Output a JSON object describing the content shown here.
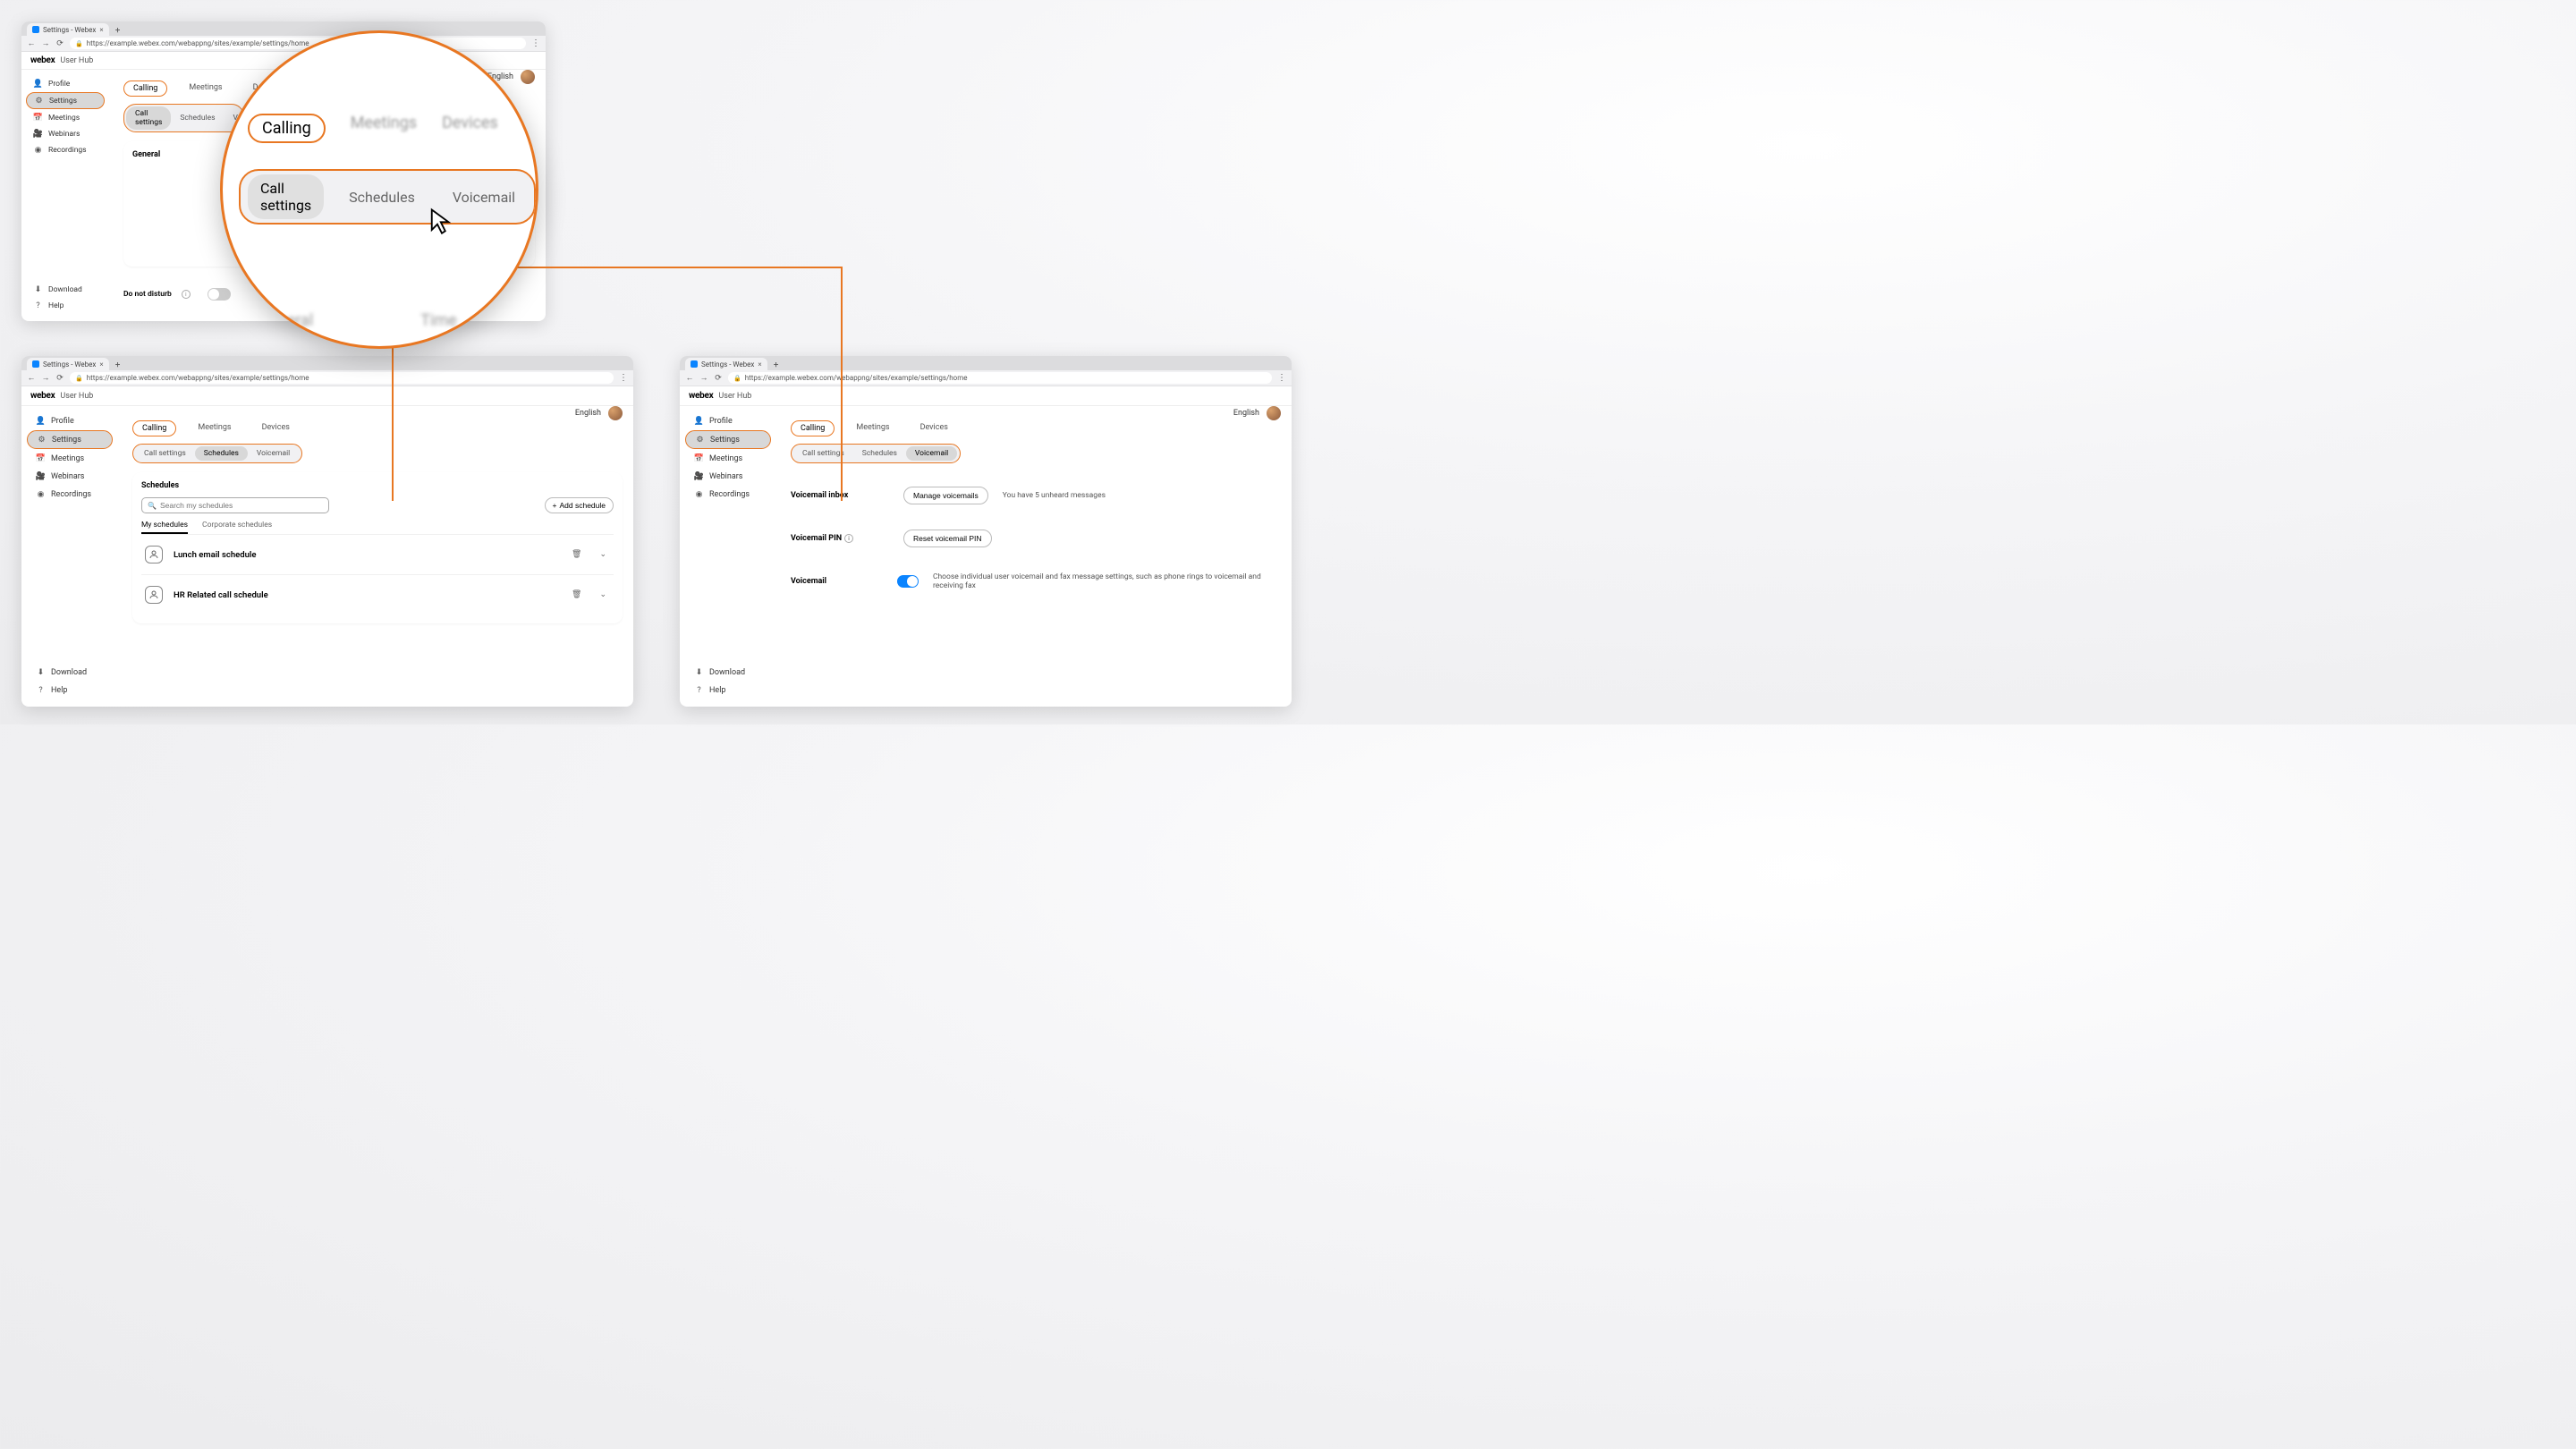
{
  "browser": {
    "tab_title": "Settings - Webex",
    "url": "https://example.webex.com/webappng/sites/example/settings/home"
  },
  "header": {
    "brand": "webex",
    "hub": "User Hub",
    "language": "English"
  },
  "sidebar": {
    "items": [
      {
        "id": "profile",
        "label": "Profile",
        "icon": "👤"
      },
      {
        "id": "settings",
        "label": "Settings",
        "icon": "⚙"
      },
      {
        "id": "meetings",
        "label": "Meetings",
        "icon": "📅"
      },
      {
        "id": "webinars",
        "label": "Webinars",
        "icon": "🎥"
      },
      {
        "id": "recordings",
        "label": "Recordings",
        "icon": "◉"
      }
    ],
    "bottom": [
      {
        "id": "download",
        "label": "Download",
        "icon": "⬇"
      },
      {
        "id": "help",
        "label": "Help",
        "icon": "?"
      }
    ]
  },
  "tabs": {
    "primary": [
      "Calling",
      "Meetings",
      "Devices"
    ],
    "sub": [
      "Call settings",
      "Schedules",
      "Voicemail"
    ]
  },
  "win1": {
    "general_label": "General",
    "dnd_label": "Do not disturb"
  },
  "schedules": {
    "heading": "Schedules",
    "search_placeholder": "Search my schedules",
    "add_label": "Add schedule",
    "tabs": [
      "My schedules",
      "Corporate schedules"
    ],
    "items": [
      {
        "name": "Lunch email schedule"
      },
      {
        "name": "HR Related call schedule"
      }
    ]
  },
  "voicemail": {
    "inbox_label": "Voicemail inbox",
    "manage_btn": "Manage voicemails",
    "inbox_status": "You have 5 unheard messages",
    "pin_label": "Voicemail PIN",
    "pin_btn": "Reset voicemail PIN",
    "vm_label": "Voicemail",
    "vm_desc": "Choose individual user voicemail and fax message settings, such as phone rings to voicemail and receiving fax"
  },
  "magnifier": {
    "primary": [
      "Calling",
      "Meetings",
      "Devices"
    ],
    "sub": [
      "Call settings",
      "Schedules",
      "Voicemail"
    ],
    "bottom": [
      "General",
      "Time"
    ]
  }
}
